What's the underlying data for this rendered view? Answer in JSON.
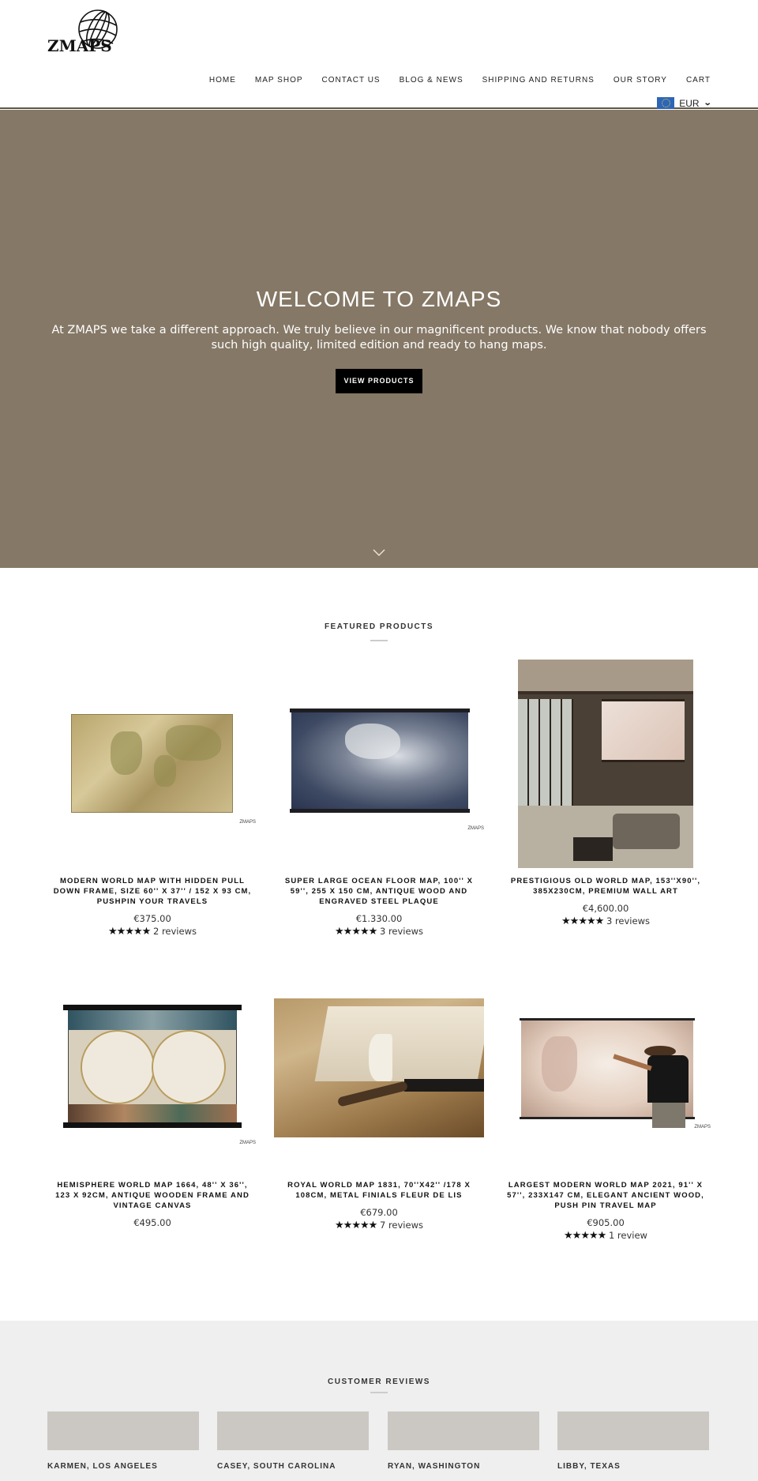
{
  "header": {
    "logo_text": "ZMAPS",
    "nav": [
      "HOME",
      "MAP SHOP",
      "CONTACT US",
      "BLOG & NEWS",
      "SHIPPING AND RETURNS",
      "OUR STORY",
      "CART"
    ],
    "currency": {
      "flag": "eu-flag-icon",
      "code": "EUR",
      "icon": "chevron-down-icon"
    }
  },
  "hero": {
    "title": "WELCOME TO ZMAPS",
    "text": "At ZMAPS we take a different approach. We truly believe in our magnificent products. We know that nobody offers such high quality, limited edition and ready to hang maps.",
    "button": "VIEW PRODUCTS",
    "scroll_icon": "chevron-down-icon",
    "bg_color": "#857866"
  },
  "featured": {
    "title": "FEATURED PRODUCTS",
    "products": [
      {
        "title": "MODERN WORLD MAP WITH HIDDEN PULL DOWN FRAME, SIZE 60'' X 37'' / 152 X 93 CM, PUSHPIN YOUR TRAVELS",
        "price": "€375.00",
        "stars": "★★★★★",
        "reviews": "2 reviews",
        "image": "antique-world-map"
      },
      {
        "title": "SUPER LARGE OCEAN FLOOR MAP, 100'' X 59'', 255 X 150 CM, ANTIQUE WOOD AND ENGRAVED STEEL PLAQUE",
        "price": "€1.330.00",
        "stars": "★★★★★",
        "reviews": "3 reviews",
        "image": "ocean-floor-map"
      },
      {
        "title": "PRESTIGIOUS OLD WORLD MAP, 153''X90'', 385X230CM, PREMIUM WALL ART",
        "price": "€4,600.00",
        "stars": "★★★★★",
        "reviews": "3 reviews",
        "image": "living-room-map"
      },
      {
        "title": "HEMISPHERE WORLD MAP 1664, 48'' X 36'', 123 X 92CM, ANTIQUE WOODEN FRAME AND VINTAGE CANVAS",
        "price": "€495.00",
        "stars": "",
        "reviews": "",
        "image": "hemisphere-map"
      },
      {
        "title": "ROYAL WORLD MAP 1831, 70''X42'' /178 X 108CM, METAL FINIALS FLEUR DE LIS",
        "price": "€679.00",
        "stars": "★★★★★",
        "reviews": "7 reviews",
        "image": "fleur-de-lis-finial"
      },
      {
        "title": "LARGEST MODERN WORLD MAP 2021, 91'' X 57'', 233X147 CM, ELEGANT ANCIENT WOOD, PUSH PIN TRAVEL MAP",
        "price": "€905.00",
        "stars": "★★★★★",
        "reviews": "1 review",
        "image": "man-pointing-map"
      }
    ]
  },
  "reviews": {
    "title": "CUSTOMER REVIEWS",
    "items": [
      {
        "name": "KARMEN, LOS ANGELES"
      },
      {
        "name": "CASEY, SOUTH CAROLINA"
      },
      {
        "name": "RYAN, WASHINGTON"
      },
      {
        "name": "LIBBY, TEXAS"
      }
    ]
  }
}
